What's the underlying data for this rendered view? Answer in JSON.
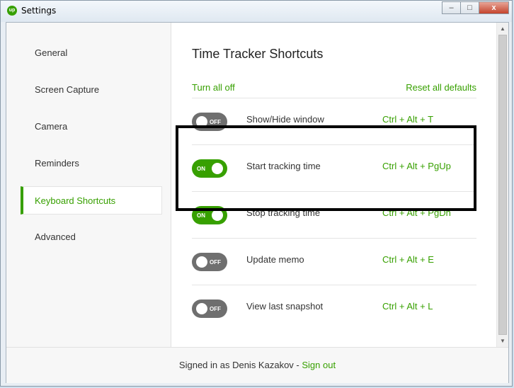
{
  "window": {
    "title": "Settings",
    "app_icon_text": "up",
    "controls": {
      "minimize": "–",
      "maximize": "□",
      "close": "x"
    }
  },
  "sidebar": {
    "items": [
      {
        "label": "General",
        "active": false
      },
      {
        "label": "Screen Capture",
        "active": false
      },
      {
        "label": "Camera",
        "active": false
      },
      {
        "label": "Reminders",
        "active": false
      },
      {
        "label": "Keyboard Shortcuts",
        "active": true
      },
      {
        "label": "Advanced",
        "active": false
      }
    ]
  },
  "main": {
    "title": "Time Tracker Shortcuts",
    "turn_all_off": "Turn all off",
    "reset_defaults": "Reset all defaults",
    "shortcuts": [
      {
        "label": "Show/Hide window",
        "keys": "Ctrl + Alt + T",
        "enabled": false,
        "toggle_text": "OFF"
      },
      {
        "label": "Start tracking time",
        "keys": "Ctrl + Alt + PgUp",
        "enabled": true,
        "toggle_text": "ON"
      },
      {
        "label": "Stop tracking time",
        "keys": "Ctrl + Alt + PgDn",
        "enabled": true,
        "toggle_text": "ON"
      },
      {
        "label": "Update memo",
        "keys": "Ctrl + Alt + E",
        "enabled": false,
        "toggle_text": "OFF"
      },
      {
        "label": "View last snapshot",
        "keys": "Ctrl + Alt + L",
        "enabled": false,
        "toggle_text": "OFF"
      }
    ]
  },
  "footer": {
    "signed_in_text": "Signed in as Denis Kazakov - ",
    "sign_out": "Sign out"
  },
  "colors": {
    "accent": "#37a000",
    "toggle_off": "#6f6f6f"
  }
}
